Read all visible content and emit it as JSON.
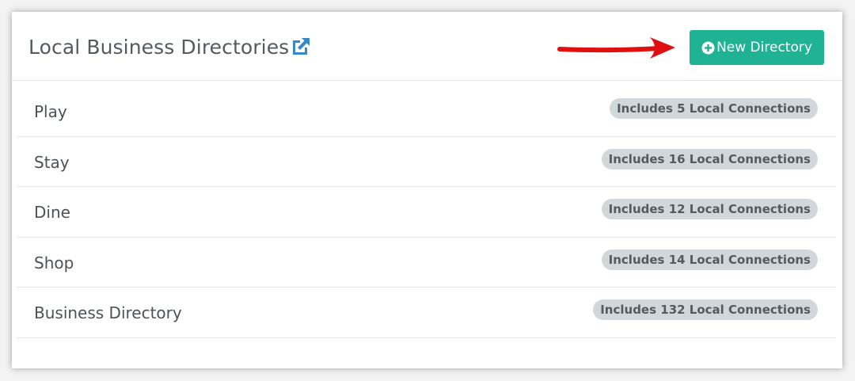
{
  "header": {
    "title": "Local Business Directories",
    "new_button_label": "New Directory"
  },
  "colors": {
    "accent": "#1fb394",
    "link": "#3a87c7",
    "arrow": "#e01010",
    "badge_bg": "#d2d7dc"
  },
  "directories": [
    {
      "name": "Play",
      "badge": "Includes 5 Local Connections"
    },
    {
      "name": "Stay",
      "badge": "Includes 16 Local Connections"
    },
    {
      "name": "Dine",
      "badge": "Includes 12 Local Connections"
    },
    {
      "name": "Shop",
      "badge": "Includes 14 Local Connections"
    },
    {
      "name": "Business Directory",
      "badge": "Includes 132 Local Connections"
    }
  ]
}
